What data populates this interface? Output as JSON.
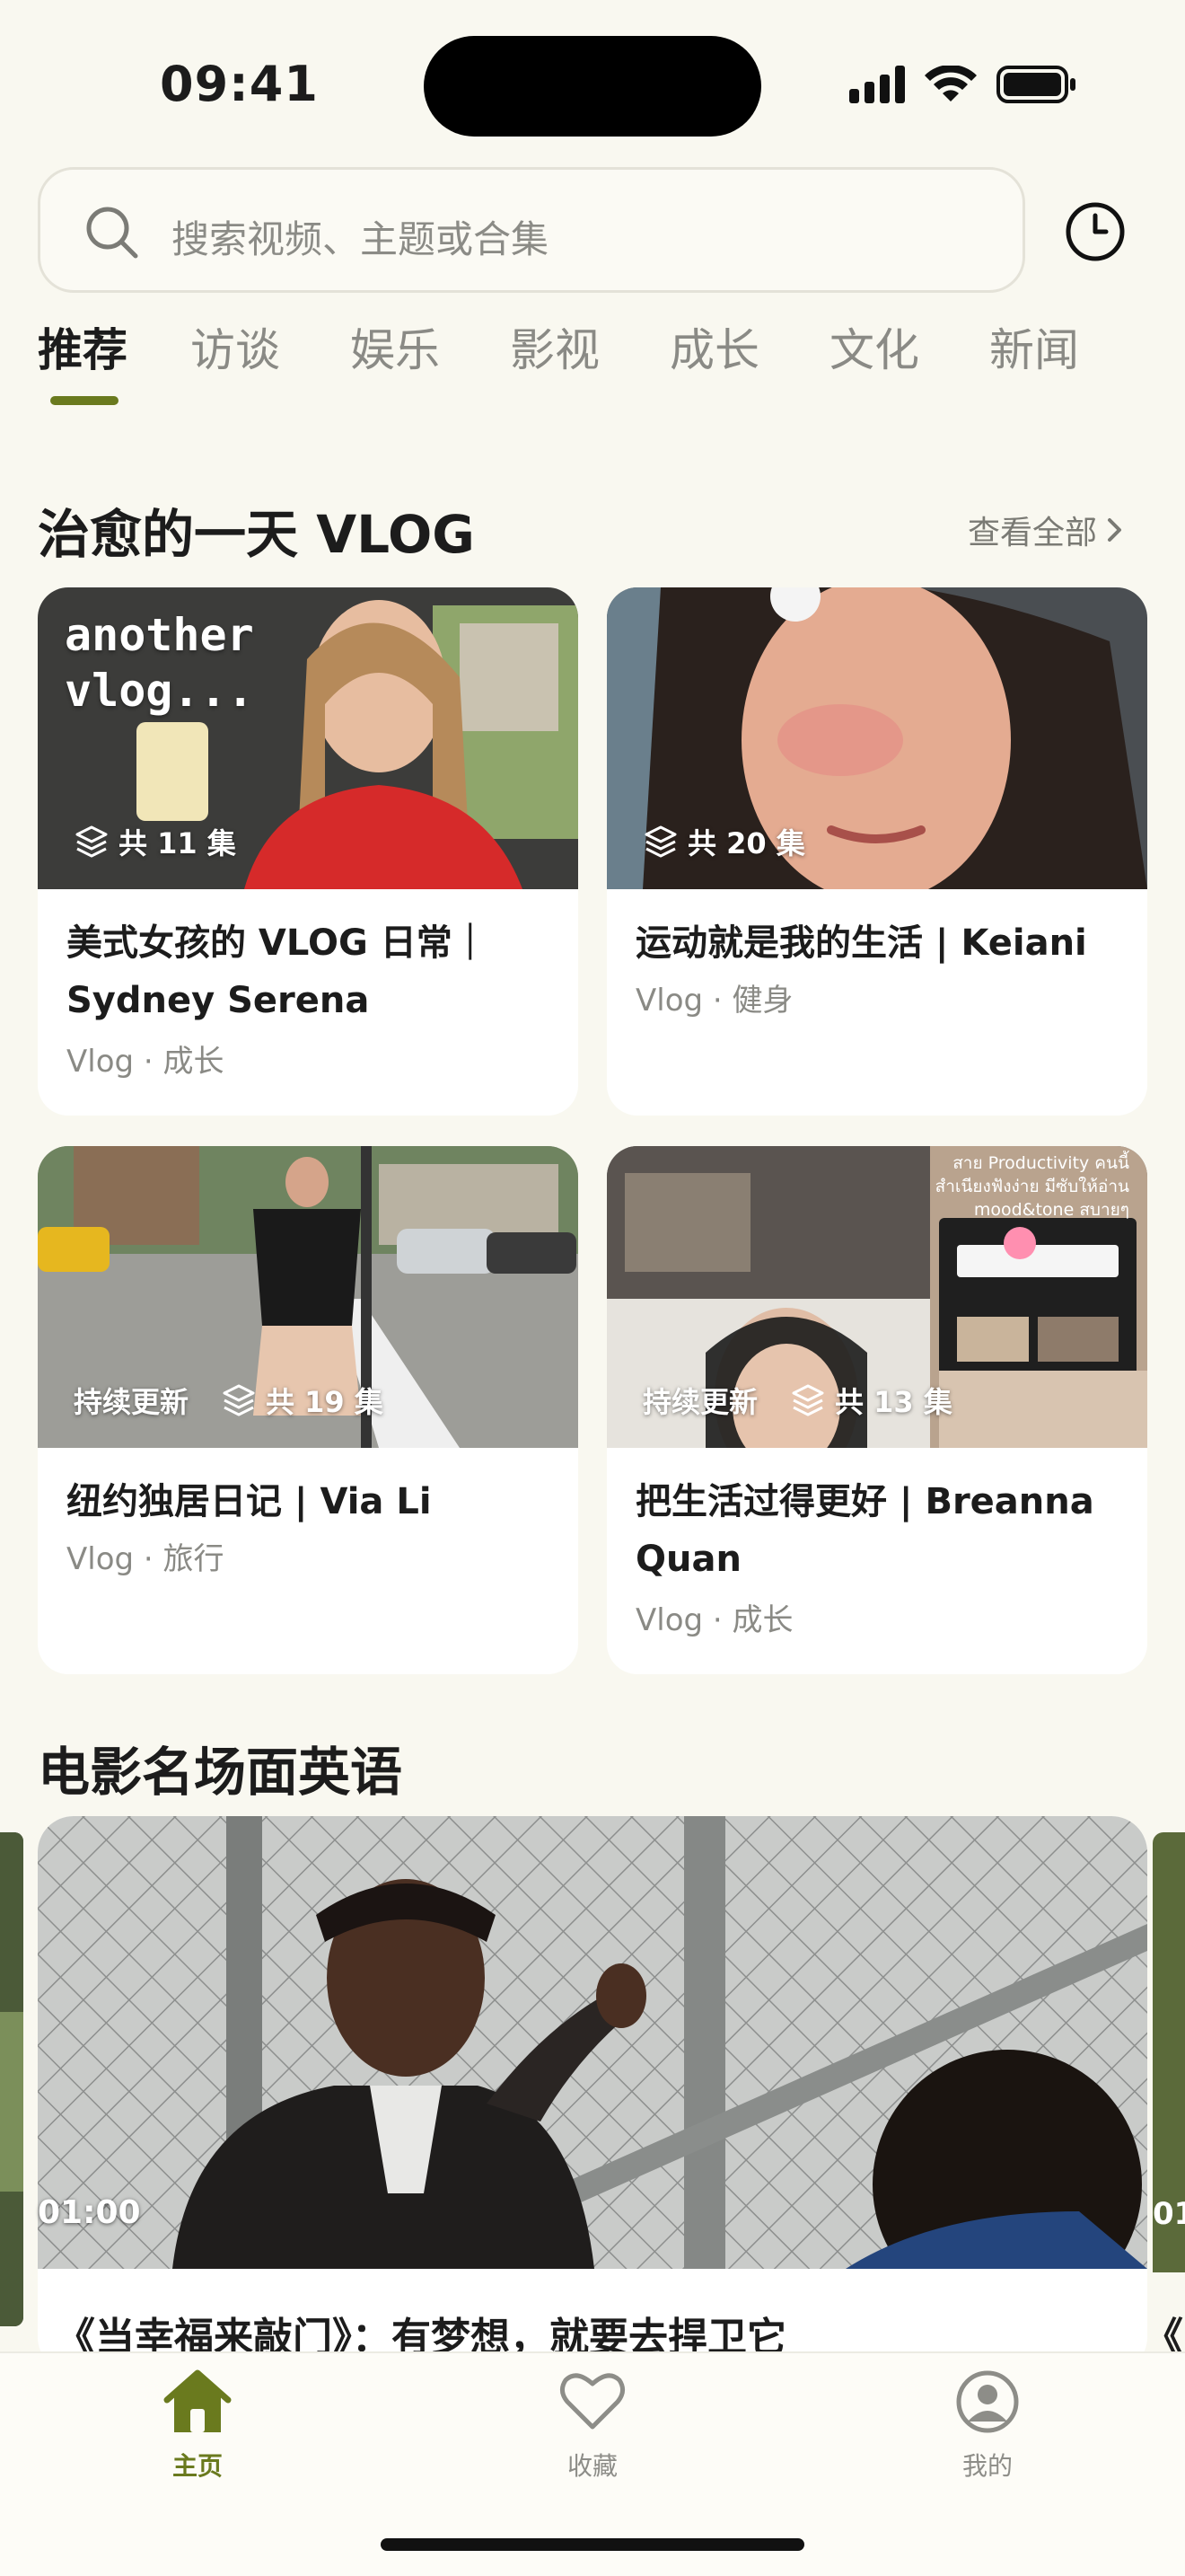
{
  "status_bar": {
    "time": "09:41"
  },
  "search": {
    "placeholder": "搜索视频、主题或合集"
  },
  "tabs": [
    "推荐",
    "访谈",
    "娱乐",
    "影视",
    "成长",
    "文化",
    "新闻"
  ],
  "active_tab": "推荐",
  "vlog_section": {
    "title": "治愈的一天 VLOG",
    "view_all": "查看全部",
    "cards": [
      {
        "thumb_text": "another\nvlog...",
        "status": "",
        "episodes": "共 11 集",
        "title": "美式女孩的 VLOG 日常｜Sydney Serena",
        "meta": "Vlog · 成长"
      },
      {
        "status": "",
        "episodes": "共 20 集",
        "title": "运动就是我的生活 | Keiani",
        "meta": "Vlog · 健身"
      },
      {
        "status": "持续更新",
        "episodes": "共 19 集",
        "title": "纽约独居日记 | Via Li",
        "meta": "Vlog · 旅行"
      },
      {
        "thumb_text": "สาย Productivity คนนี้ สำเนียงฟังง่าย มีซับให้อ่าน mood&tone สบายๆ",
        "status": "持续更新",
        "episodes": "共 13 集",
        "title": "把生活过得更好 | Breanna Quan",
        "meta": "Vlog · 成长"
      }
    ]
  },
  "movie_section": {
    "title": "电影名场面英语",
    "items": [
      {
        "duration": "01:00",
        "title": "《当幸福来敲门》：有梦想，就要去捍卫它"
      },
      {
        "duration": "01",
        "title": "《阿"
      }
    ]
  },
  "tab_bar": {
    "items": [
      {
        "label": "主页",
        "icon": "home-icon",
        "active": true
      },
      {
        "label": "收藏",
        "icon": "heart-icon",
        "active": false
      },
      {
        "label": "我的",
        "icon": "profile-icon",
        "active": false
      }
    ]
  },
  "colors": {
    "accent": "#6a7a1e",
    "background": "#f9f8f0",
    "muted": "#8a8a85"
  }
}
